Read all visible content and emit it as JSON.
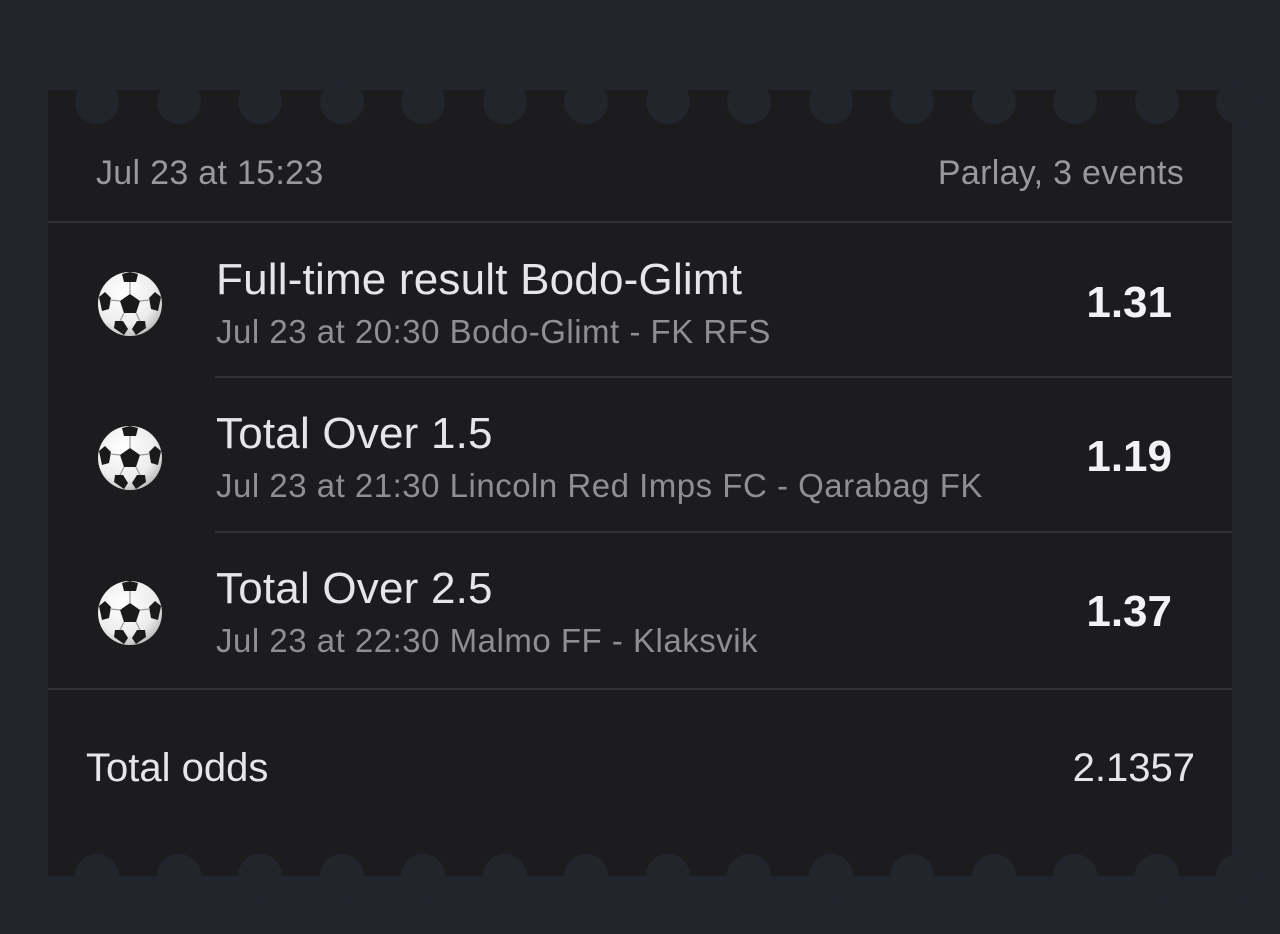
{
  "bet": {
    "placed_at": "Jul 23 at 15:23",
    "type": "Parlay, 3 events"
  },
  "events": [
    {
      "icon": "soccer-ball-icon",
      "title": "Full-time result Bodo-Glimt",
      "details": "Jul 23 at 20:30 Bodo-Glimt - FK RFS",
      "odds": "1.31"
    },
    {
      "icon": "soccer-ball-icon",
      "title": "Total Over 1.5",
      "details": "Jul 23 at 21:30 Lincoln Red Imps FC - Qarabag FK",
      "odds": "1.19"
    },
    {
      "icon": "soccer-ball-icon",
      "title": "Total Over 2.5",
      "details": "Jul 23 at 22:30 Malmo FF - Klaksvik",
      "odds": "1.37"
    }
  ],
  "total": {
    "label": "Total odds",
    "value": "2.1357"
  },
  "colors": {
    "page_background": "#23252d",
    "ticket_background": "#1c1c1f",
    "primary_text": "#e6e6ea",
    "secondary_text": "#8e8e93",
    "separator": "#323236"
  }
}
